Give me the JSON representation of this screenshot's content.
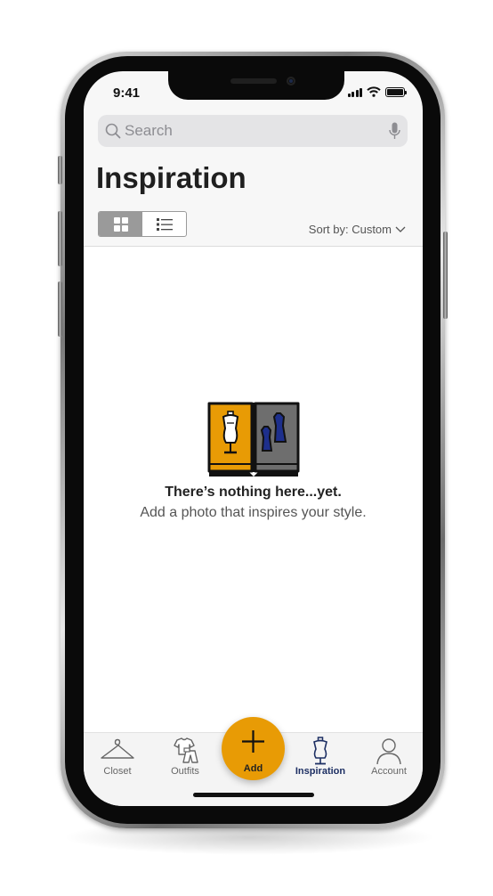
{
  "status": {
    "time": "9:41"
  },
  "search": {
    "placeholder": "Search"
  },
  "page": {
    "title": "Inspiration"
  },
  "sort": {
    "label": "Sort by: Custom"
  },
  "empty_state": {
    "title": "There’s nothing here...yet.",
    "subtitle": "Add a photo that inspires your style."
  },
  "tabs": [
    {
      "label": "Closet",
      "icon": "hanger-icon"
    },
    {
      "label": "Outfits",
      "icon": "outfits-icon"
    },
    {
      "label": "Add",
      "icon": "plus-icon"
    },
    {
      "label": "Inspiration",
      "icon": "dress-form-icon",
      "active": true
    },
    {
      "label": "Account",
      "icon": "person-icon"
    }
  ],
  "colors": {
    "accent": "#e89b05",
    "active_tab": "#1d2f63",
    "toggle_active": "#9a9a9a"
  }
}
